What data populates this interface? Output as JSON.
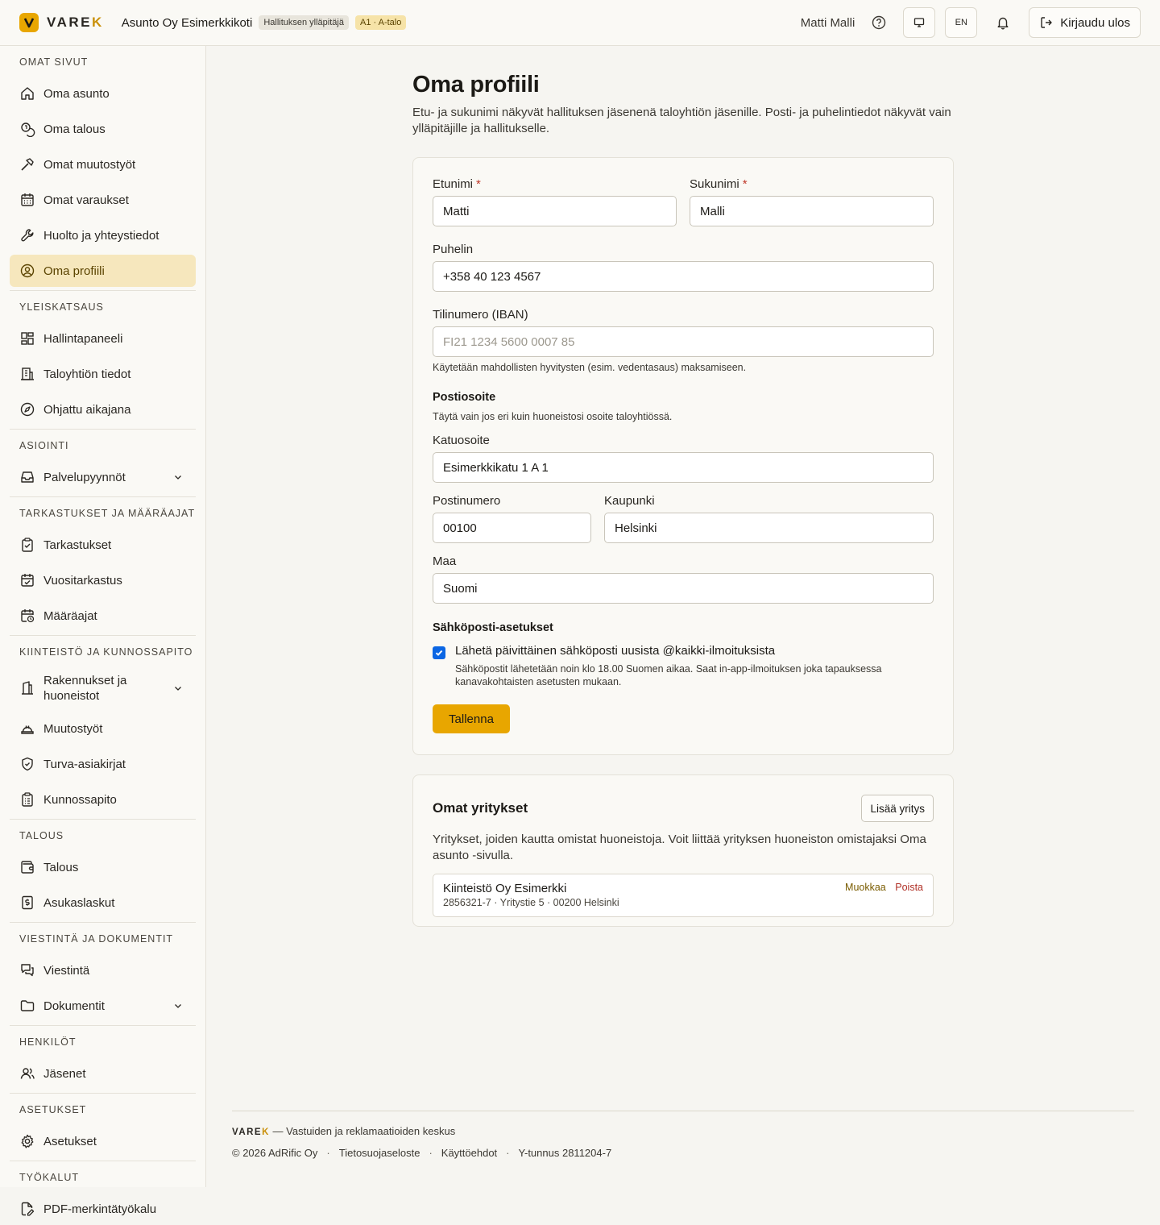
{
  "header": {
    "logo_text": "VARE",
    "logo_accent": "K",
    "org_name": "Asunto Oy Esimerkkikoti",
    "role_badge": "Hallituksen ylläpitäjä",
    "unit_badge": "A1 · A-talo",
    "user_name": "Matti Malli",
    "lang_button": "EN",
    "logout_label": "Kirjaudu ulos",
    "accent_color": "#e8a600"
  },
  "sidebar": {
    "sections": [
      {
        "title": "OMAT SIVUT",
        "items": [
          "Oma asunto",
          "Oma talous",
          "Omat muutostyöt",
          "Omat varaukset",
          "Huolto ja yhteystiedot",
          "Oma profiili"
        ]
      },
      {
        "title": "YLEISKATSAUS",
        "items": [
          "Hallintapaneeli",
          "Taloyhtiön tiedot",
          "Ohjattu aikajana"
        ]
      },
      {
        "title": "ASIOINTI",
        "items": [
          "Palvelupyynnöt"
        ]
      },
      {
        "title": "TARKASTUKSET JA MÄÄRÄAJAT",
        "items": [
          "Tarkastukset",
          "Vuositarkastus",
          "Määräajat"
        ]
      },
      {
        "title": "KIINTEISTÖ JA KUNNOSSAPITO",
        "items": [
          "Rakennukset ja huoneistot",
          "Muutostyöt",
          "Turva-asiakirjat",
          "Kunnossapito"
        ]
      },
      {
        "title": "TALOUS",
        "items": [
          "Talous",
          "Asukaslaskut"
        ]
      },
      {
        "title": "VIESTINTÄ JA DOKUMENTIT",
        "items": [
          "Viestintä",
          "Dokumentit"
        ]
      },
      {
        "title": "HENKILÖT",
        "items": [
          "Jäsenet"
        ]
      },
      {
        "title": "ASETUKSET",
        "items": [
          "Asetukset"
        ]
      },
      {
        "title": "TYÖKALUT",
        "items": [
          "PDF-merkintätyökalu"
        ]
      }
    ],
    "active_item": "Oma profiili"
  },
  "page": {
    "title": "Oma profiili",
    "lead": "Etu- ja sukunimi näkyvät hallituksen jäsenenä taloyhtiön jäsenille. Posti- ja puhelintiedot näkyvät vain ylläpitäjille ja hallitukselle."
  },
  "form": {
    "first_name_label": "Etunimi",
    "first_name_value": "Matti",
    "last_name_label": "Sukunimi",
    "last_name_value": "Malli",
    "required_mark": "*",
    "phone_label": "Puhelin",
    "phone_value": "+358 40 123 4567",
    "iban_label": "Tilinumero (IBAN)",
    "iban_placeholder": "FI21 1234 5600 0007 85",
    "iban_help": "Käytetään mahdollisten hyvitysten (esim. vedentasaus) maksamiseen.",
    "postal_heading": "Postiosoite",
    "postal_help": "Täytä vain jos eri kuin huoneistosi osoite taloyhtiössä.",
    "street_label": "Katuosoite",
    "street_value": "Esimerkkikatu 1 A 1",
    "zip_label": "Postinumero",
    "zip_value": "00100",
    "city_label": "Kaupunki",
    "city_value": "Helsinki",
    "country_label": "Maa",
    "country_value": "Suomi",
    "email_heading": "Sähköposti-asetukset",
    "email_checkbox_label": "Lähetä päivittäinen sähköposti uusista @kaikki-ilmoituksista",
    "email_checkbox_checked": true,
    "email_help": "Sähköpostit lähetetään noin klo 18.00 Suomen aikaa. Saat in-app-ilmoituksen joka tapauksessa kanavakohtaisten asetusten mukaan.",
    "save_label": "Tallenna"
  },
  "companies": {
    "title": "Omat yritykset",
    "add_label": "Lisää yritys",
    "description": "Yritykset, joiden kautta omistat huoneistoja. Voit liittää yrityksen huoneiston omistajaksi Oma asunto -sivulla.",
    "items": [
      {
        "name": "Kiinteistö Oy Esimerkki",
        "meta": "2856321-7 · Yritystie 5 · 00200 Helsinki",
        "edit": "Muokkaa",
        "delete": "Poista"
      }
    ]
  },
  "footer": {
    "brand": "VARE",
    "brand_accent": "K",
    "tagline": "— Vastuiden ja reklamaatioiden keskus",
    "copyright": "© 2026 AdRific Oy",
    "privacy": "Tietosuojaseloste",
    "terms": "Käyttöehdot",
    "business_id": "Y-tunnus 2811204-7",
    "separator": "·"
  }
}
